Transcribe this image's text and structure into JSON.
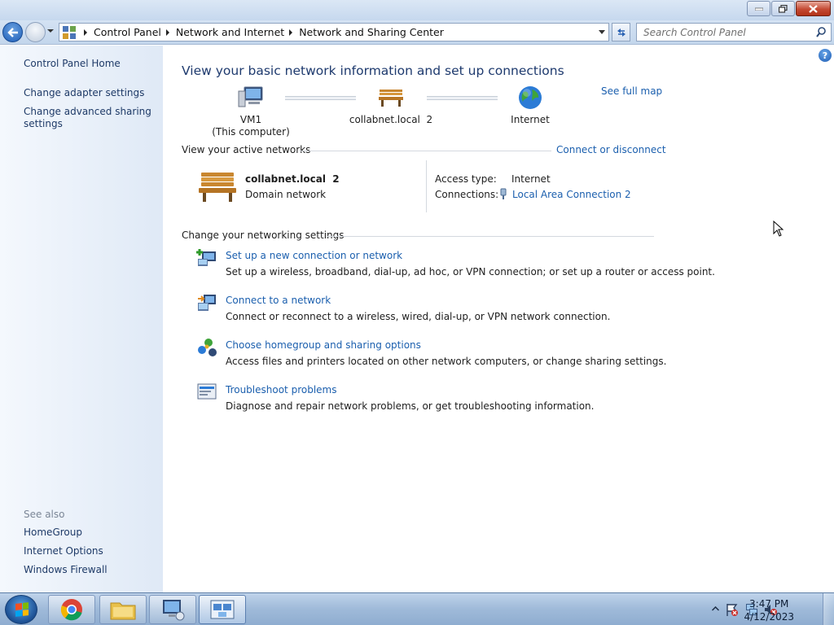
{
  "address_bar": {
    "crumbs": [
      "Control Panel",
      "Network and Internet",
      "Network and Sharing Center"
    ],
    "search_placeholder": "Search Control Panel"
  },
  "sidebar": {
    "home": "Control Panel Home",
    "items": [
      "Change adapter settings",
      "Change advanced sharing\nsettings"
    ],
    "see_also_label": "See also",
    "see_also": [
      "HomeGroup",
      "Internet Options",
      "Windows Firewall"
    ]
  },
  "main": {
    "title": "View your basic network information and set up connections",
    "see_full_map": "See full map",
    "map": {
      "computer_name": "VM1",
      "computer_sub": "(This computer)",
      "network": "collabnet.local  2",
      "internet": "Internet"
    },
    "active_networks": {
      "heading": "View your active networks",
      "connect_link": "Connect or disconnect",
      "network_name": "collabnet.local  2",
      "network_type": "Domain network",
      "access_type_label": "Access type:",
      "access_type_value": "Internet",
      "connections_label": "Connections:",
      "connections_value": "Local Area Connection 2"
    },
    "settings": {
      "heading": "Change your networking settings",
      "tasks": [
        {
          "title": "Set up a new connection or network",
          "desc": "Set up a wireless, broadband, dial-up, ad hoc, or VPN connection; or set up a router or access point."
        },
        {
          "title": "Connect to a network",
          "desc": "Connect or reconnect to a wireless, wired, dial-up, or VPN network connection."
        },
        {
          "title": "Choose homegroup and sharing options",
          "desc": "Access files and printers located on other network computers, or change sharing settings."
        },
        {
          "title": "Troubleshoot problems",
          "desc": "Diagnose and repair network problems, or get troubleshooting information."
        }
      ]
    }
  },
  "taskbar": {
    "time": "3:47 PM",
    "date": "4/12/2023",
    "pinned": [
      "chrome-icon",
      "folder-icon",
      "remote-desktop-icon",
      "network-center-icon"
    ]
  },
  "colors": {
    "link": "#1b5fae",
    "title": "#1e3a6e",
    "sidebar_bg": "#dfe9f6"
  }
}
